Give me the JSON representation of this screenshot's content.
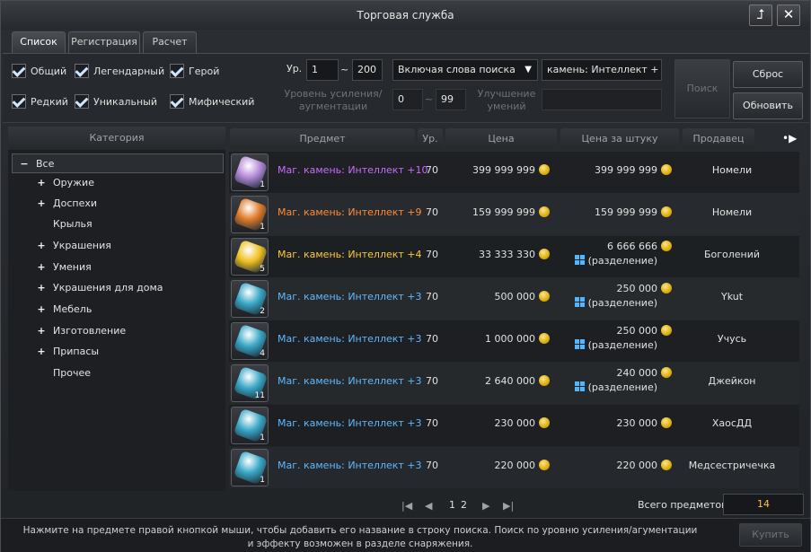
{
  "window": {
    "title": "Торговая служба"
  },
  "tabs": [
    "Список",
    "Регистрация",
    "Расчет"
  ],
  "filters": {
    "grades": [
      "Общий",
      "Легендарный",
      "Герой",
      "Редкий",
      "Уникальный",
      "Мифический"
    ],
    "level_label": "Ур.",
    "level_min": "1",
    "level_max": "200",
    "level_sep": "~",
    "enhance_label": "Уровень усиления/\nаугментации",
    "enhance_min": "0",
    "enhance_max": "99",
    "search_mode": "Включая слова поиска",
    "search_value": "камень: Интеллект +",
    "skill_label": "Улучшение\nумений",
    "search_button": "Поиск",
    "reset_button": "Сброс",
    "refresh_button": "Обновить"
  },
  "categories": {
    "header": "Категория",
    "items": [
      {
        "label": "Все",
        "expand": "−"
      },
      {
        "label": "Оружие",
        "expand": "+"
      },
      {
        "label": "Доспехи",
        "expand": "+"
      },
      {
        "label": "Крылья",
        "expand": ""
      },
      {
        "label": "Украшения",
        "expand": "+"
      },
      {
        "label": "Умения",
        "expand": "+"
      },
      {
        "label": "Украшения для дома",
        "expand": "+"
      },
      {
        "label": "Мебель",
        "expand": "+"
      },
      {
        "label": "Изготовление",
        "expand": "+"
      },
      {
        "label": "Припасы",
        "expand": "+"
      },
      {
        "label": "Прочее",
        "expand": ""
      }
    ]
  },
  "table": {
    "headers": [
      "Предмет",
      "Ур.",
      "Цена",
      "Цена за штуку",
      "Продавец"
    ],
    "rows": [
      {
        "name": "Маг. камень: Интеллект +10",
        "color": "#c86bff",
        "gem": "#b58ad8",
        "qty": "1",
        "level": "70",
        "price": "399 999 999",
        "unit": "399 999 999",
        "split": "",
        "seller": "Номели"
      },
      {
        "name": "Маг. камень: Интеллект +9",
        "color": "#ff8c3a",
        "gem": "#e07a2a",
        "qty": "1",
        "level": "70",
        "price": "159 999 999",
        "unit": "159 999 999",
        "split": "",
        "seller": "Номели"
      },
      {
        "name": "Маг. камень: Интеллект +4",
        "color": "#ffc83a",
        "gem": "#f0c020",
        "qty": "5",
        "level": "70",
        "price": "33 333 330",
        "unit": "6 666 666",
        "split": "(разделение)",
        "seller": "Боголений"
      },
      {
        "name": "Маг. камень: Интеллект +3",
        "color": "#5fb8ff",
        "gem": "#3aa8c8",
        "qty": "2",
        "level": "70",
        "price": "500 000",
        "unit": "250 000",
        "split": "(разделение)",
        "seller": "Ykut"
      },
      {
        "name": "Маг. камень: Интеллект +3",
        "color": "#5fb8ff",
        "gem": "#3aa8c8",
        "qty": "4",
        "level": "70",
        "price": "1 000 000",
        "unit": "250 000",
        "split": "(разделение)",
        "seller": "Учусь"
      },
      {
        "name": "Маг. камень: Интеллект +3",
        "color": "#5fb8ff",
        "gem": "#3aa8c8",
        "qty": "11",
        "level": "70",
        "price": "2 640 000",
        "unit": "240 000",
        "split": "(разделение)",
        "seller": "Джейкон"
      },
      {
        "name": "Маг. камень: Интеллект +3",
        "color": "#5fb8ff",
        "gem": "#3aa8c8",
        "qty": "1",
        "level": "70",
        "price": "230 000",
        "unit": "230 000",
        "split": "",
        "seller": "ХаосДД"
      },
      {
        "name": "Маг. камень: Интеллект +3",
        "color": "#5fb8ff",
        "gem": "#3aa8c8",
        "qty": "1",
        "level": "70",
        "price": "220 000",
        "unit": "220 000",
        "split": "",
        "seller": "Медсестричечка"
      }
    ]
  },
  "pagination": {
    "pages": [
      "1",
      "2"
    ],
    "total_label": "Всего предметов",
    "total_value": "14"
  },
  "footer": {
    "hint": "Нажмите на предмете правой кнопкой мыши, чтобы добавить его название в строку поиска. Поиск по уровню усиления/агументации и эффекту возможен в разделе снаряжения.",
    "buy_button": "Купить"
  },
  "colors": {
    "accent": "#ffd060",
    "split_icon": "#4fb6ff"
  }
}
